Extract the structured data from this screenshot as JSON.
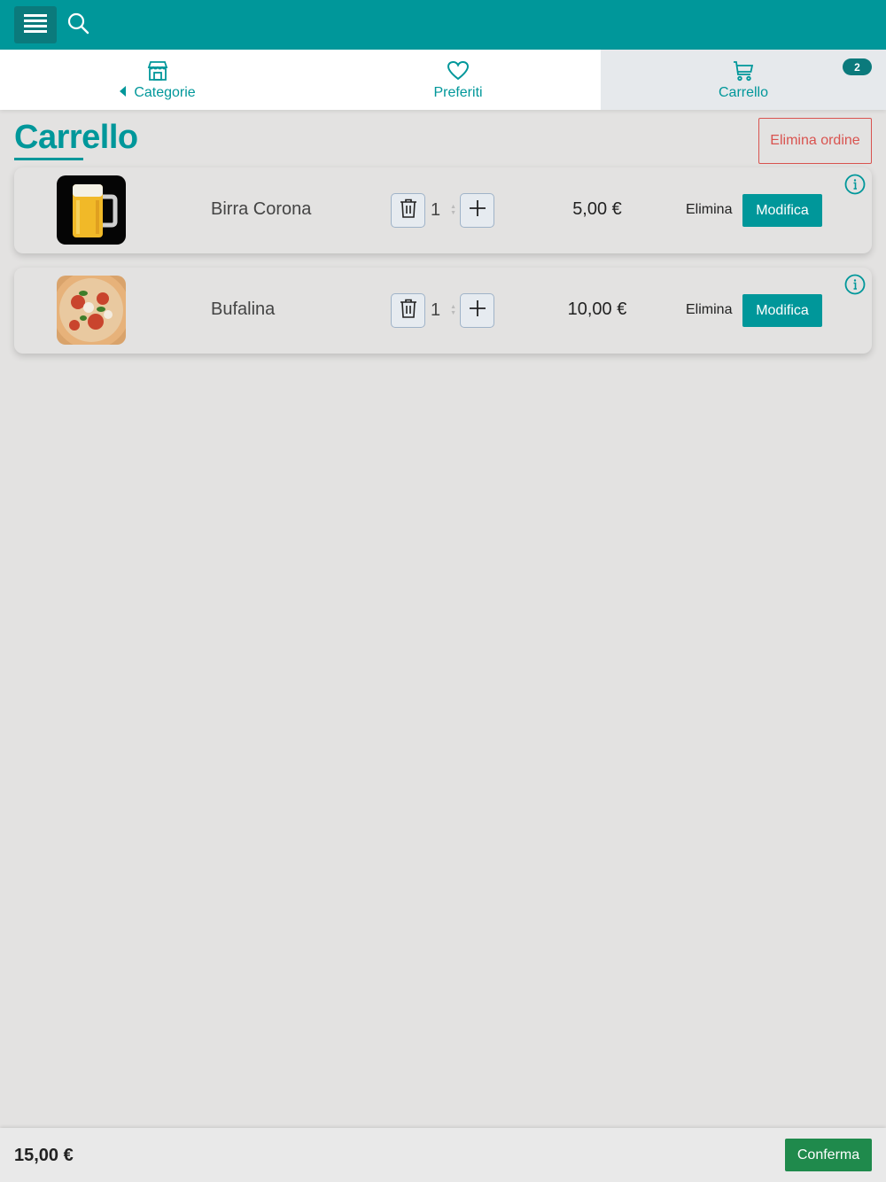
{
  "header": {
    "menu_icon": "hamburger-icon",
    "search_icon": "search-icon"
  },
  "tabs": [
    {
      "label": "Categorie",
      "icon": "store-icon",
      "has_back_arrow": true
    },
    {
      "label": "Preferiti",
      "icon": "heart-icon"
    },
    {
      "label": "Carrello",
      "icon": "cart-icon",
      "badge": "2",
      "active": true
    }
  ],
  "page": {
    "title": "Carrello",
    "delete_order_label": "Elimina ordine"
  },
  "cart_items": [
    {
      "name": "Birra Corona",
      "quantity": "1",
      "price": "5,00 €",
      "delete_label": "Elimina",
      "edit_label": "Modifica",
      "image": "beer-mug-image"
    },
    {
      "name": "Bufalina",
      "quantity": "1",
      "price": "10,00 €",
      "delete_label": "Elimina",
      "edit_label": "Modifica",
      "image": "pizza-image"
    }
  ],
  "footer": {
    "total": "15,00 €",
    "confirm_label": "Conferma"
  },
  "colors": {
    "primary": "#00979a",
    "primary_dark": "#0b7a7c",
    "danger": "#d9534f",
    "confirm": "#1f8a4c",
    "background": "#e3e2e1"
  }
}
